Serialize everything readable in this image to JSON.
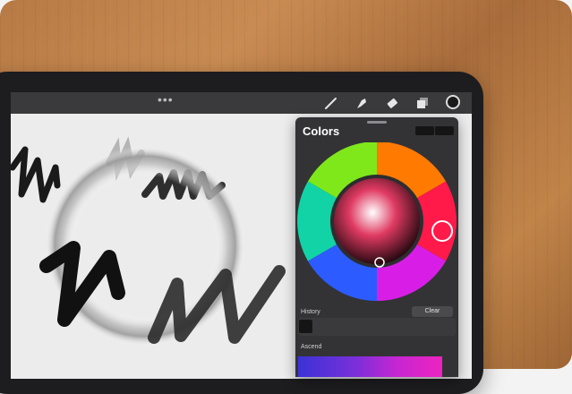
{
  "topbar": {
    "more_glyph": "•••",
    "tools": [
      "brush-icon",
      "smudge-icon",
      "eraser-icon",
      "layers-icon",
      "color-icon"
    ]
  },
  "colors_panel": {
    "title": "Colors",
    "history_label": "History",
    "clear_label": "Clear",
    "ascend_label": "Ascend",
    "selected_color": "#e6194b"
  },
  "theme": {
    "panel_bg": "#333336",
    "toolbar_bg": "#3a3a3c",
    "wood": "#b87a45"
  }
}
